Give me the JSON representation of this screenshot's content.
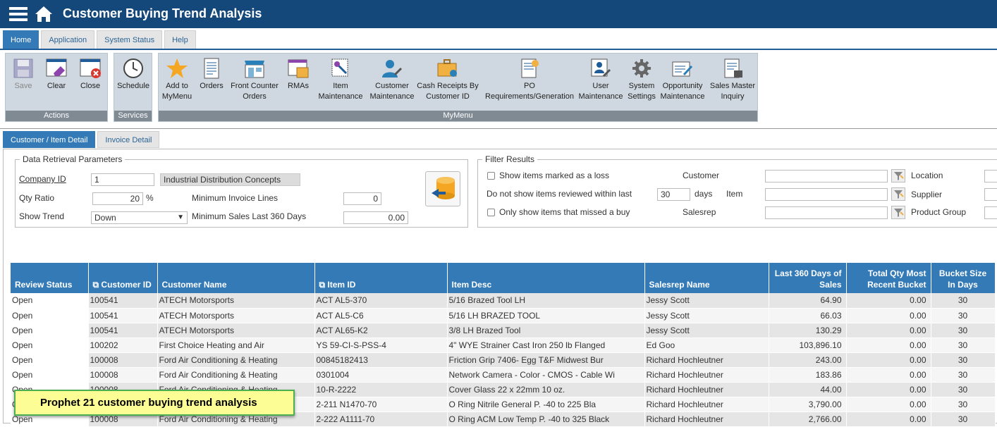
{
  "window": {
    "title": "Customer Buying Trend Analysis"
  },
  "tabs": [
    {
      "label": "Home"
    },
    {
      "label": "Application"
    },
    {
      "label": "System Status"
    },
    {
      "label": "Help"
    }
  ],
  "ribbon": {
    "groups": {
      "actions": "Actions",
      "services": "Services",
      "mymenu": "MyMenu"
    },
    "buttons": {
      "save": "Save",
      "clear": "Clear",
      "close": "Close",
      "schedule": "Schedule",
      "add_to_mymenu": "Add to MyMenu",
      "orders": "Orders",
      "front_counter_orders": "Front Counter Orders",
      "rmas": "RMAs",
      "item_maintenance": "Item Maintenance",
      "customer_maintenance": "Customer Maintenance",
      "cash_receipts": "Cash Receipts By Customer ID",
      "po_requirements": "PO Requirements/Generation",
      "user_maintenance": "User Maintenance",
      "system_settings": "System Settings",
      "opportunity_maintenance": "Opportunity Maintenance",
      "sales_master_inquiry": "Sales Master Inquiry"
    }
  },
  "subtabs": [
    {
      "label": "Customer / Item Detail"
    },
    {
      "label": "Invoice Detail"
    }
  ],
  "params": {
    "legend": "Data Retrieval Parameters",
    "company_id_label": "Company ID",
    "company_id": "1",
    "company_name": "Industrial Distribution Concepts",
    "qty_ratio_label": "Qty Ratio",
    "qty_ratio": "20",
    "percent": "%",
    "min_invoice_lines_label": "Minimum Invoice Lines",
    "min_invoice_lines": "0",
    "show_trend_label": "Show Trend",
    "show_trend": "Down",
    "min_sales_label": "Minimum Sales Last 360 Days",
    "min_sales": "0.00"
  },
  "filter": {
    "legend": "Filter Results",
    "show_loss": "Show items marked as a loss",
    "not_reviewed": "Do not show items reviewed within last",
    "days_value": "30",
    "days": "days",
    "missed_buy": "Only show items that missed a buy",
    "customer": "Customer",
    "item": "Item",
    "salesrep": "Salesrep",
    "location": "Location",
    "supplier": "Supplier",
    "product_group": "Product Group"
  },
  "grid": {
    "columns": [
      "Review Status",
      "Customer ID",
      "Customer Name",
      "Item ID",
      "Item Desc",
      "Salesrep Name",
      "Last 360 Days of Sales",
      "Total Qty Most Recent Bucket",
      "Bucket Size In Days"
    ],
    "rows": [
      [
        "Open",
        "100541",
        "ATECH Motorsports",
        "ACT AL5-370",
        "5/16 Brazed Tool LH",
        "Jessy Scott",
        "64.90",
        "0.00",
        "30"
      ],
      [
        "Open",
        "100541",
        "ATECH Motorsports",
        "ACT AL5-C6",
        "5/16 LH BRAZED TOOL",
        "Jessy Scott",
        "66.03",
        "0.00",
        "30"
      ],
      [
        "Open",
        "100541",
        "ATECH Motorsports",
        "ACT AL65-K2",
        "3/8 LH Brazed Tool",
        "Jessy Scott",
        "130.29",
        "0.00",
        "30"
      ],
      [
        "Open",
        "100202",
        "First Choice Heating and Air",
        "YS 59-CI-S-PSS-4",
        "4\" WYE Strainer Cast Iron 250 lb Flanged",
        "Ed Goo",
        "103,896.10",
        "0.00",
        "30"
      ],
      [
        "Open",
        "100008",
        "Ford Air Conditioning & Heating",
        "00845182413",
        "Friction Grip 7406- Egg T&F Midwest Bur",
        "Richard Hochleutner",
        "243.00",
        "0.00",
        "30"
      ],
      [
        "Open",
        "100008",
        "Ford Air Conditioning & Heating",
        "0301004",
        "Network Camera - Color - CMOS - Cable Wi",
        "Richard Hochleutner",
        "183.86",
        "0.00",
        "30"
      ],
      [
        "Open",
        "100008",
        "Ford Air Conditioning & Heating",
        "10-R-2222",
        "Cover Glass 22 x 22mm 10 oz.",
        "Richard Hochleutner",
        "44.00",
        "0.00",
        "30"
      ],
      [
        "Open",
        "100008",
        "Ford Air Conditioning & Heating",
        "2-211 N1470-70",
        "O Ring Nitrile General P. -40 to 225 Bla",
        "Richard Hochleutner",
        "3,790.00",
        "0.00",
        "30"
      ],
      [
        "Open",
        "100008",
        "Ford Air Conditioning & Heating",
        "2-222 A1111-70",
        "O Ring ACM Low Temp P. -40 to 325 Black",
        "Richard Hochleutner",
        "2,766.00",
        "0.00",
        "30"
      ]
    ]
  },
  "caption": "Prophet 21 customer buying trend analysis"
}
